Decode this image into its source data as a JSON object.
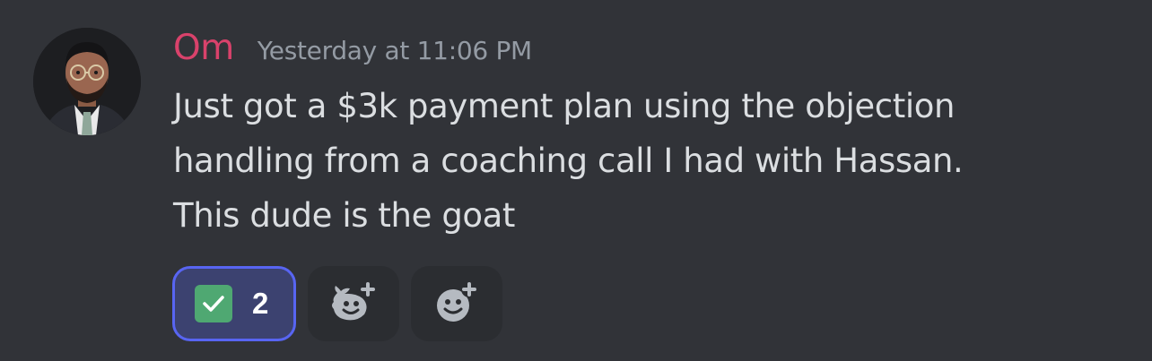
{
  "message": {
    "author": "Om",
    "timestamp": "Yesterday at 11:06 PM",
    "content_lines": [
      "Just got a $3k payment plan using the objection",
      "handling from a coaching call I had with Hassan.",
      "This dude is the goat"
    ],
    "author_color": "#d9426b"
  },
  "reactions": [
    {
      "emoji": "white-check-mark-icon",
      "count": "2",
      "active": true
    }
  ],
  "actions": {
    "add_super_reaction_icon": "super-reaction-add-icon",
    "add_reaction_icon": "emoji-add-icon"
  },
  "colors": {
    "background": "#313338",
    "reaction_active_bg": "#3c4270",
    "reaction_active_border": "#5865f2",
    "text": "#dbdee1",
    "timestamp": "#949ba4"
  }
}
